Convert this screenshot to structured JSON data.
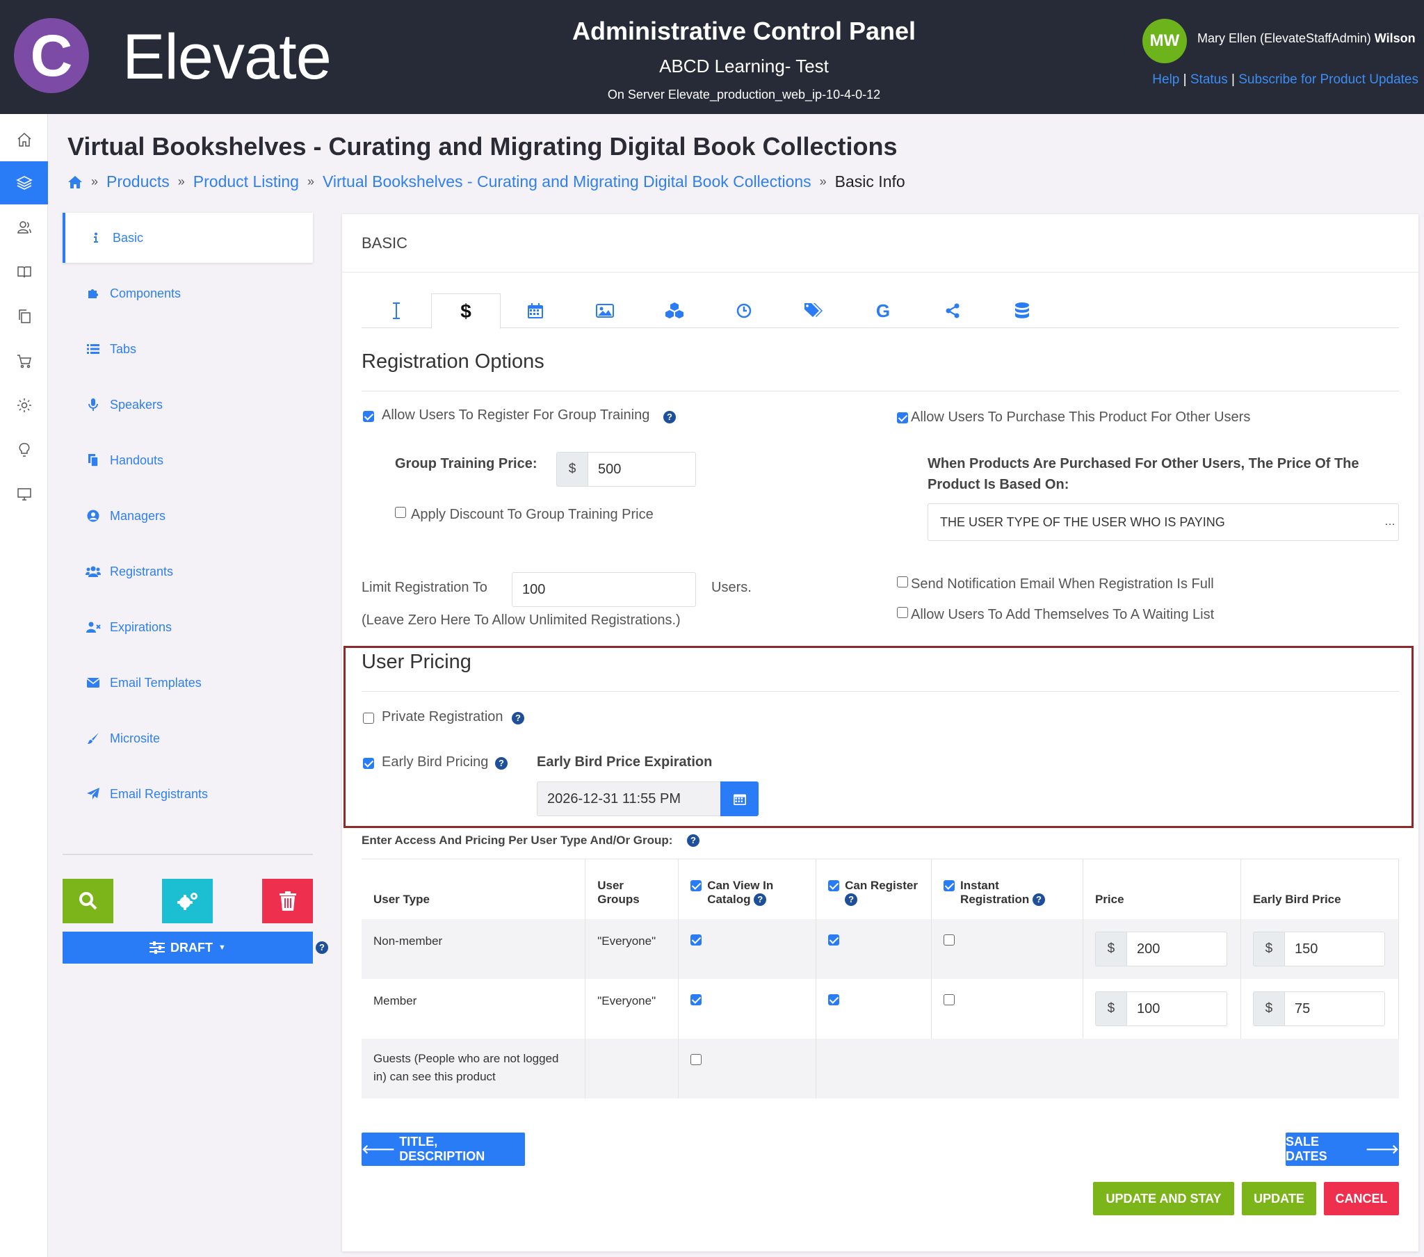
{
  "header": {
    "logo_letter": "C",
    "logo_text": "Elevate",
    "title": "Administrative Control Panel",
    "subtitle": "ABCD Learning- Test",
    "server": "On Server Elevate_production_web_ip-10-4-0-12",
    "avatar_initials": "MW",
    "user_first": "Mary Ellen (ElevateStaffAdmin)",
    "user_last": "Wilson",
    "links": [
      "Help",
      "Status",
      "Subscribe for Product Updates"
    ]
  },
  "page": {
    "title": "Virtual Bookshelves - Curating and Migrating Digital Book Collections",
    "breadcrumb": [
      "Products",
      "Product Listing",
      "Virtual Bookshelves - Curating and Migrating Digital Book Collections",
      "Basic Info"
    ]
  },
  "leftnav": {
    "items": [
      "Basic",
      "Components",
      "Tabs",
      "Speakers",
      "Handouts",
      "Managers",
      "Registrants",
      "Expirations",
      "Email Templates",
      "Microsite",
      "Email Registrants"
    ],
    "draft_label": "DRAFT"
  },
  "card": {
    "heading": "BASIC",
    "registration": {
      "title": "Registration Options",
      "group_training_label": "Allow Users To Register For Group Training",
      "group_price_label": "Group Training Price:",
      "currency": "$",
      "group_price": "500",
      "apply_discount_label": "Apply Discount To Group Training Price",
      "purchase_for_others_label": "Allow Users To Purchase This Product For Other Users",
      "price_based_on_label": "When Products Are Purchased For Other Users, The Price Of The Product Is Based On:",
      "price_based_on_value": "The User Type Of The User Who Is Paying",
      "limit_label": "Limit Registration To",
      "limit_value": "100",
      "users_suffix": "Users.",
      "limit_hint": "(Leave Zero Here To Allow Unlimited Registrations.)",
      "notify_full_label": "Send Notification Email When Registration Is Full",
      "waiting_list_label": "Allow Users To Add Themselves To A Waiting List"
    },
    "user_pricing": {
      "title": "User Pricing",
      "private_label": "Private Registration",
      "early_bird_label": "Early Bird Pricing",
      "early_bird_exp_label": "Early Bird Price Expiration",
      "early_bird_exp_value": "2026-12-31 11:55 PM"
    },
    "table": {
      "intro": "Enter Access And Pricing Per User Type And/Or Group:",
      "headers": [
        "User Type",
        "User Groups",
        "Can View In Catalog",
        "Can Register",
        "Instant Registration",
        "Price",
        "Early Bird Price"
      ],
      "rows": [
        {
          "type": "Non-member",
          "groups": "\"Everyone\"",
          "price": "200",
          "early": "150"
        },
        {
          "type": "Member",
          "groups": "\"Everyone\"",
          "price": "100",
          "early": "75"
        }
      ],
      "guest_label": "Guests (People who are not logged in) can see this product"
    },
    "buttons": {
      "prev": "TITLE, DESCRIPTION",
      "next": "SALE DATES",
      "update_stay": "UPDATE AND STAY",
      "update": "UPDATE",
      "cancel": "CANCEL"
    }
  },
  "colors": {
    "header_bg": "#272a37",
    "accent": "#2a7cf6",
    "green": "#7cb51a",
    "teal": "#1bbfd1",
    "red": "#ee2f4d",
    "highlight_border": "#8d2a2a"
  }
}
